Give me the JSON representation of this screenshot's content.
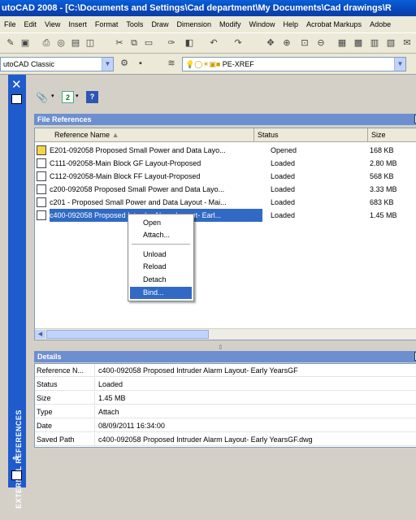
{
  "window": {
    "title": "utoCAD 2008 - [C:\\Documents and Settings\\Cad department\\My Documents\\Cad drawings\\R"
  },
  "menubar": [
    "File",
    "Edit",
    "View",
    "Insert",
    "Format",
    "Tools",
    "Draw",
    "Dimension",
    "Modify",
    "Window",
    "Help",
    "Acrobat Markups",
    "Adobe"
  ],
  "toolbar": {
    "workspace": "utoCAD Classic",
    "layer": "PE-XREF"
  },
  "xref_palette": {
    "side_title": "EXTERNAL REFERENCES",
    "file_references": {
      "title": "File References",
      "columns": [
        "Reference Name",
        "Status",
        "Size"
      ],
      "rows": [
        {
          "name": "E201-092058 Proposed Small Power and Data Layo...",
          "status": "Opened",
          "size": "168 KB"
        },
        {
          "name": "C111-092058-Main Block GF Layout-Proposed",
          "status": "Loaded",
          "size": "2.80 MB"
        },
        {
          "name": "C112-092058-Main Block FF Layout-Proposed",
          "status": "Loaded",
          "size": "568 KB"
        },
        {
          "name": "c200-092058 Proposed Small Power and Data Layo...",
          "status": "Loaded",
          "size": "3.33 MB"
        },
        {
          "name": "c201 - Proposed Small Power and Data Layout - Mai...",
          "status": "Loaded",
          "size": "683 KB"
        },
        {
          "name": "c400-092058 Proposed Intruder Alarm Layout- Earl...",
          "status": "Loaded",
          "size": "1.45 MB"
        }
      ]
    },
    "context_menu": [
      "Open",
      "Attach...",
      "Unload",
      "Reload",
      "Detach",
      "Bind..."
    ],
    "details": {
      "title": "Details",
      "rows": [
        {
          "key": "Reference N...",
          "value": "c400-092058 Proposed Intruder Alarm Layout- Early YearsGF"
        },
        {
          "key": "Status",
          "value": "Loaded"
        },
        {
          "key": "Size",
          "value": "1.45 MB"
        },
        {
          "key": "Type",
          "value": "Attach"
        },
        {
          "key": "Date",
          "value": "08/09/2011 16:34:00"
        },
        {
          "key": "Saved Path",
          "value": "c400-092058 Proposed Intruder Alarm Layout- Early YearsGF.dwg"
        }
      ]
    }
  }
}
